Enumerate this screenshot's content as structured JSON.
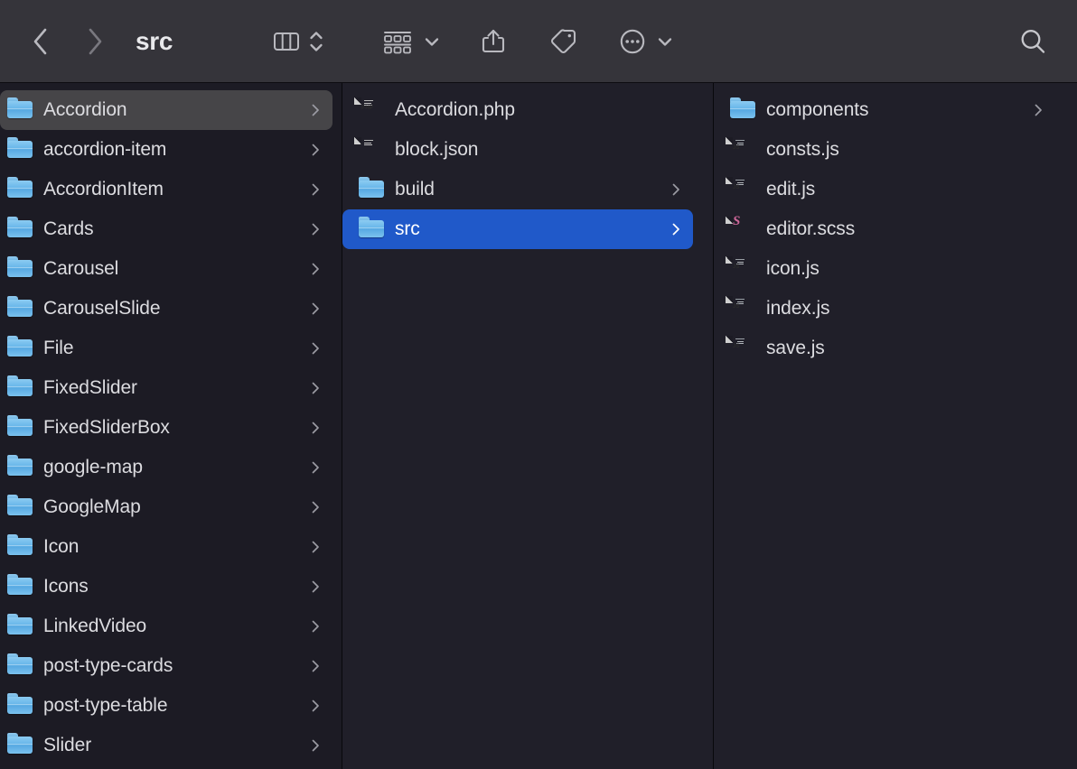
{
  "window": {
    "title": "src"
  },
  "toolbar": {
    "back_label": "Back",
    "forward_label": "Forward",
    "view_label": "Column View",
    "view_options_label": "View Options",
    "group_label": "Group Items",
    "group_menu_label": "Group Menu",
    "share_label": "Share",
    "tag_label": "Tags",
    "more_label": "More",
    "more_menu_label": "More Menu",
    "search_label": "Search",
    "icons": {
      "back": "chevron-left-icon",
      "forward": "chevron-right-icon",
      "view": "column-view-icon",
      "view_stepper": "chevron-up-down-icon",
      "group": "group-grid-icon",
      "group_chevron": "chevron-down-icon",
      "share": "share-icon",
      "tag": "tag-icon",
      "more": "ellipsis-circle-icon",
      "more_chevron": "chevron-down-icon",
      "search": "search-icon"
    }
  },
  "colors": {
    "toolbar_bg": "#35343A",
    "column_bg": "#201F29",
    "column_bg_first": "#1C1B24",
    "selection_active": "#2059C9",
    "selection_inactive": "#464548",
    "text": "#DCDCE0",
    "text_selected": "#FFFFFF",
    "folder_blue": "#64B4E9",
    "sass_pink": "#CD6799"
  },
  "columns": [
    {
      "name": "column-1",
      "items": [
        {
          "label": "Accordion",
          "kind": "folder",
          "chevron": true,
          "selected": "inactive"
        },
        {
          "label": "accordion-item",
          "kind": "folder",
          "chevron": true,
          "selected": "none"
        },
        {
          "label": "AccordionItem",
          "kind": "folder",
          "chevron": true,
          "selected": "none"
        },
        {
          "label": "Cards",
          "kind": "folder",
          "chevron": true,
          "selected": "none"
        },
        {
          "label": "Carousel",
          "kind": "folder",
          "chevron": true,
          "selected": "none"
        },
        {
          "label": "CarouselSlide",
          "kind": "folder",
          "chevron": true,
          "selected": "none"
        },
        {
          "label": "File",
          "kind": "folder",
          "chevron": true,
          "selected": "none"
        },
        {
          "label": "FixedSlider",
          "kind": "folder",
          "chevron": true,
          "selected": "none"
        },
        {
          "label": "FixedSliderBox",
          "kind": "folder",
          "chevron": true,
          "selected": "none"
        },
        {
          "label": "google-map",
          "kind": "folder",
          "chevron": true,
          "selected": "none"
        },
        {
          "label": "GoogleMap",
          "kind": "folder",
          "chevron": true,
          "selected": "none"
        },
        {
          "label": "Icon",
          "kind": "folder",
          "chevron": true,
          "selected": "none"
        },
        {
          "label": "Icons",
          "kind": "folder",
          "chevron": true,
          "selected": "none"
        },
        {
          "label": "LinkedVideo",
          "kind": "folder",
          "chevron": true,
          "selected": "none"
        },
        {
          "label": "post-type-cards",
          "kind": "folder",
          "chevron": true,
          "selected": "none"
        },
        {
          "label": "post-type-table",
          "kind": "folder",
          "chevron": true,
          "selected": "none"
        },
        {
          "label": "Slider",
          "kind": "folder",
          "chevron": true,
          "selected": "none"
        }
      ]
    },
    {
      "name": "column-2",
      "items": [
        {
          "label": "Accordion.php",
          "kind": "file",
          "ext": "PHP",
          "chevron": false,
          "selected": "none"
        },
        {
          "label": "block.json",
          "kind": "file",
          "ext": "",
          "chevron": false,
          "selected": "none"
        },
        {
          "label": "build",
          "kind": "folder",
          "chevron": true,
          "selected": "none"
        },
        {
          "label": "src",
          "kind": "folder",
          "chevron": true,
          "selected": "active"
        }
      ]
    },
    {
      "name": "column-3",
      "items": [
        {
          "label": "components",
          "kind": "folder",
          "chevron": true,
          "selected": "none"
        },
        {
          "label": "consts.js",
          "kind": "file",
          "ext": "JS",
          "chevron": false,
          "selected": "none"
        },
        {
          "label": "edit.js",
          "kind": "file",
          "ext": "JS",
          "chevron": false,
          "selected": "none"
        },
        {
          "label": "editor.scss",
          "kind": "file",
          "ext": "SASS",
          "chevron": false,
          "selected": "none"
        },
        {
          "label": "icon.js",
          "kind": "file",
          "ext": "JS",
          "chevron": false,
          "selected": "none"
        },
        {
          "label": "index.js",
          "kind": "file",
          "ext": "JS",
          "chevron": false,
          "selected": "none"
        },
        {
          "label": "save.js",
          "kind": "file",
          "ext": "JS",
          "chevron": false,
          "selected": "none"
        }
      ]
    }
  ]
}
